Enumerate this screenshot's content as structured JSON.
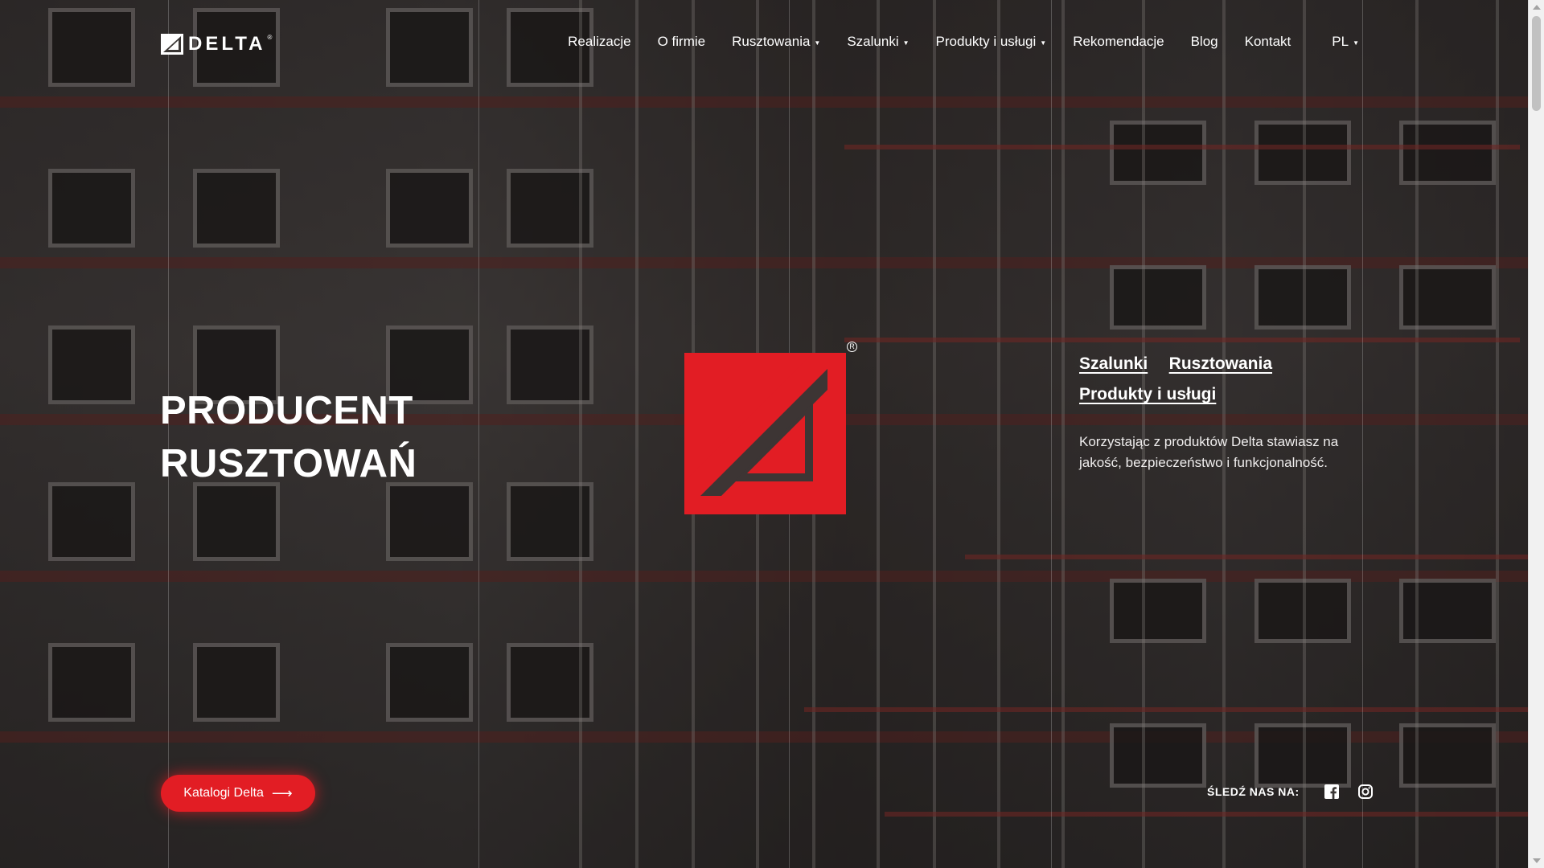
{
  "brand": {
    "name": "DELTA",
    "accent_color": "#e21d24"
  },
  "nav": {
    "items": [
      {
        "label": "Realizacje",
        "has_dropdown": false
      },
      {
        "label": "O firmie",
        "has_dropdown": false
      },
      {
        "label": "Rusztowania",
        "has_dropdown": true
      },
      {
        "label": "Szalunki",
        "has_dropdown": true
      },
      {
        "label": "Produkty i usługi",
        "has_dropdown": true
      },
      {
        "label": "Rekomendacje",
        "has_dropdown": false
      },
      {
        "label": "Blog",
        "has_dropdown": false
      },
      {
        "label": "Kontakt",
        "has_dropdown": false
      }
    ],
    "language": "PL"
  },
  "hero": {
    "title_line1": "PRODUCENT",
    "title_line2": "RUSZTOWAŃ",
    "links": [
      "Szalunki",
      "Rusztowania",
      "Produkty i usługi"
    ],
    "description": "Korzystając z produktów Delta stawiasz na jakość, bezpieczeństwo i funkcjonalność.",
    "cta_label": "Katalogi Delta",
    "follow_label": "ŚLEDŹ NAS NA:",
    "social": [
      "facebook-icon",
      "instagram-icon"
    ]
  }
}
